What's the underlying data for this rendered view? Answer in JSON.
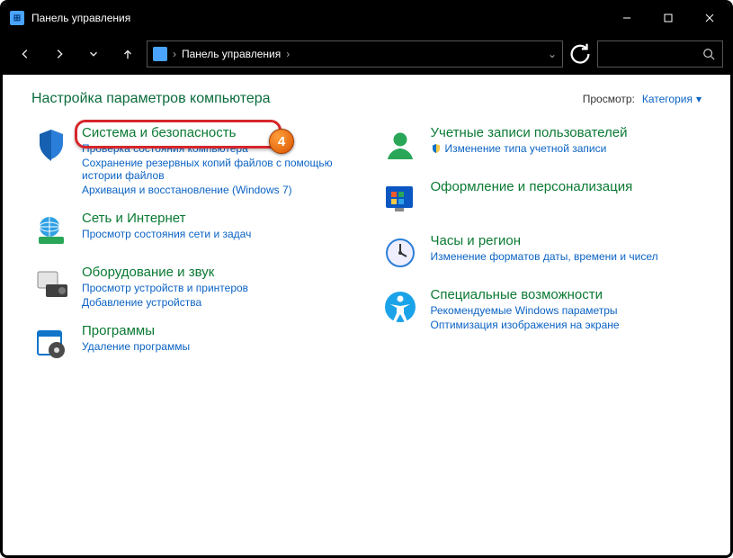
{
  "window": {
    "title": "Панель управления"
  },
  "breadcrumb": {
    "root": "Панель управления"
  },
  "header": {
    "heading": "Настройка параметров компьютера",
    "view_label": "Просмотр:",
    "view_value": "Категория"
  },
  "left": [
    {
      "name": "system-security",
      "title": "Система и безопасность",
      "subs": [
        "Проверка состояния компьютера",
        "Сохранение резервных копий файлов с помощью истории файлов",
        "Архивация и восстановление (Windows 7)"
      ],
      "highlighted": true,
      "badge": "4"
    },
    {
      "name": "network-internet",
      "title": "Сеть и Интернет",
      "subs": [
        "Просмотр состояния сети и задач"
      ]
    },
    {
      "name": "hardware-sound",
      "title": "Оборудование и звук",
      "subs": [
        "Просмотр устройств и принтеров",
        "Добавление устройства"
      ]
    },
    {
      "name": "programs",
      "title": "Программы",
      "subs": [
        "Удаление программы"
      ]
    }
  ],
  "right": [
    {
      "name": "user-accounts",
      "title": "Учетные записи пользователей",
      "subs": [
        "Изменение типа учетной записи"
      ],
      "shield": true
    },
    {
      "name": "appearance",
      "title": "Оформление и персонализация",
      "subs": []
    },
    {
      "name": "clock-region",
      "title": "Часы и регион",
      "subs": [
        "Изменение форматов даты, времени и чисел"
      ]
    },
    {
      "name": "ease-of-access",
      "title": "Специальные возможности",
      "subs": [
        "Рекомендуемые Windows параметры",
        "Оптимизация изображения на экране"
      ]
    }
  ]
}
